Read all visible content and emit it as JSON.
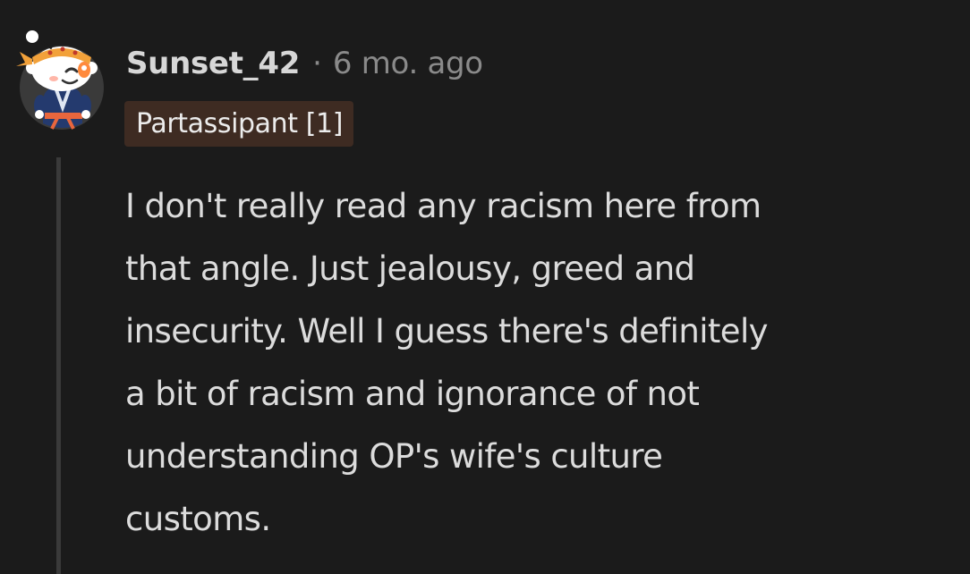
{
  "comment": {
    "author": "Sunset_42",
    "separator": "·",
    "timestamp": "6 mo. ago",
    "flair": "Partassipant [1]",
    "body_lines": [
      "I don't really read any racism here from",
      "that angle. Just jealousy, greed and",
      "insecurity. Well I guess there's definitely",
      "a bit of racism and ignorance of not",
      "understanding OP's wife's culture",
      "customs."
    ],
    "avatar_icon": "snoo-avatar-icon",
    "colors": {
      "background": "#1b1b1b",
      "flair_background": "#3e2b22",
      "thread_line": "#3a3a3a"
    }
  }
}
